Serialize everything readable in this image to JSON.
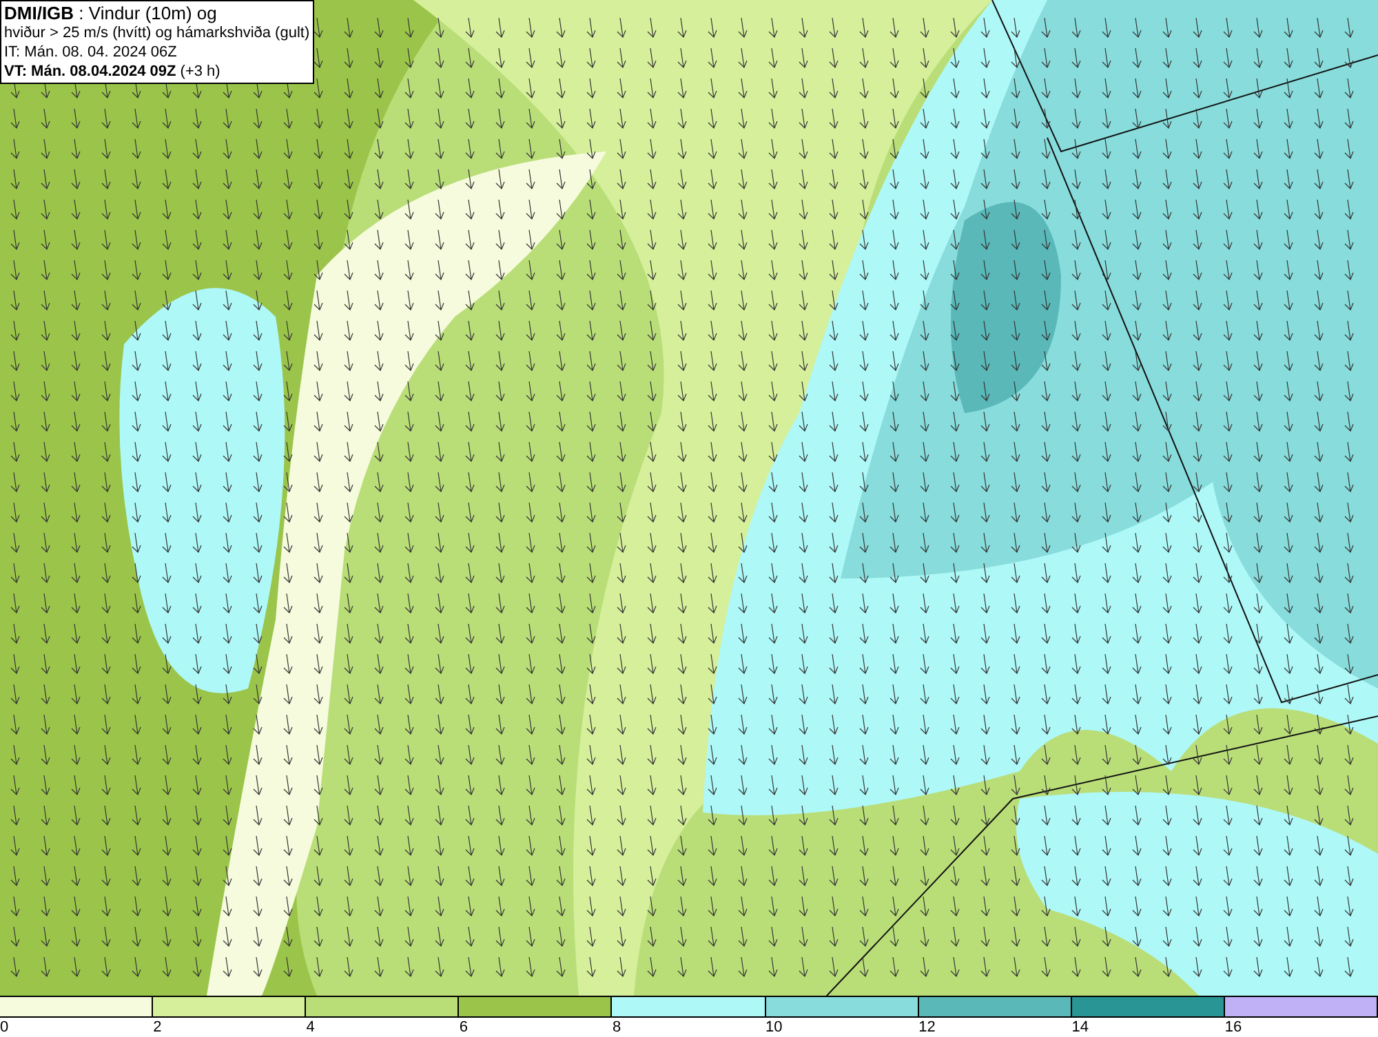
{
  "header": {
    "lines": [
      "**DMI/IGB** : Vindur (10m) og",
      "hviður > 25 m/s (hvítt) og hámarkshviða (gult)",
      "IT: Mán. 08. 04. 2024 06Z",
      "**VT: Mán. 08.04.2024 09Z** (+3 h)"
    ]
  },
  "legend": {
    "bins": [
      {
        "color": "#f5fbdc"
      },
      {
        "color": "#d6ef9b"
      },
      {
        "color": "#b9de78"
      },
      {
        "color": "#9bc54a"
      },
      {
        "color": "#aef8f8"
      },
      {
        "color": "#88dcdc"
      },
      {
        "color": "#5ab8b8"
      },
      {
        "color": "#2a9595"
      },
      {
        "color": "#c0b0f5"
      }
    ],
    "ticks": [
      "0",
      "2",
      "4",
      "6",
      "8",
      "10",
      "12",
      "14",
      "16"
    ]
  }
}
